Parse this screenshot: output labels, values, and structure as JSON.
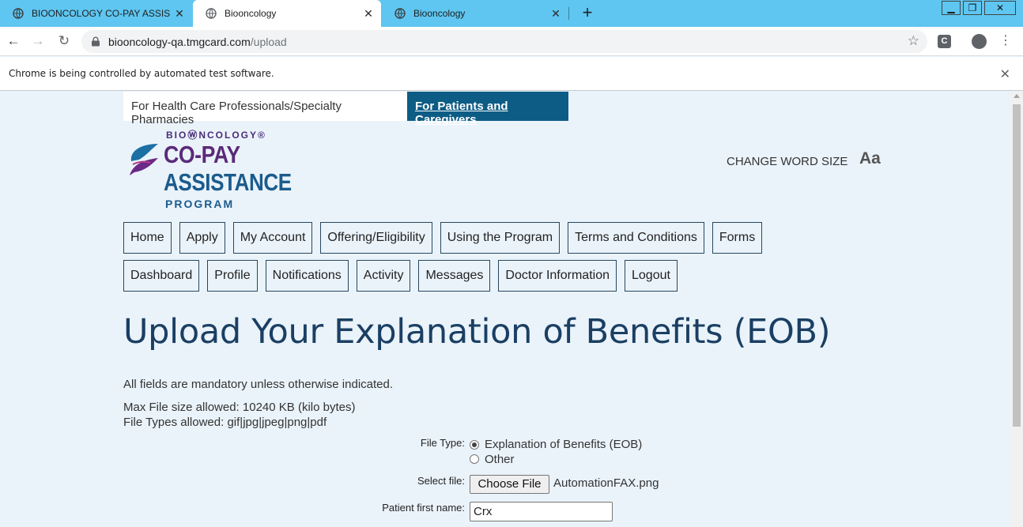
{
  "browser": {
    "tabs": [
      {
        "title": "BIOONCOLOGY CO-PAY ASSISTA",
        "active": false
      },
      {
        "title": "Biooncology",
        "active": true
      },
      {
        "title": "Biooncology",
        "active": false
      }
    ],
    "new_tab_label": "+",
    "window_controls": {
      "minimize": "▁",
      "maximize": "❐",
      "close": "✕"
    },
    "url_host": "biooncology-qa.tmgcard.com",
    "url_path": "/upload",
    "extension_label": "C",
    "automation_message": "Chrome is being controlled by automated test software."
  },
  "site": {
    "audience_tabs": {
      "hcp": "For Health Care Professionals/Specialty Pharmacies",
      "patients": "For Patients and Caregivers"
    },
    "logo": {
      "brand": "BIOⓌNCOLOGY®",
      "line1": "CO-PAY",
      "line2": "ASSISTANCE",
      "line3": "PROGRAM"
    },
    "word_size_label": "CHANGE WORD SIZE",
    "word_size_icon": "Aa",
    "nav_row_1": [
      "Home",
      "Apply",
      "My Account",
      "Offering/Eligibility",
      "Using the Program",
      "Terms and Conditions",
      "Forms"
    ],
    "nav_row_2": [
      "Dashboard",
      "Profile",
      "Notifications",
      "Activity",
      "Messages",
      "Doctor Information",
      "Logout"
    ]
  },
  "upload": {
    "heading": "Upload Your Explanation of Benefits (EOB)",
    "mandatory_note": "All fields are mandatory unless otherwise indicated.",
    "max_size": "Max File size allowed: 10240 KB (kilo bytes)",
    "file_types": "File Types allowed: gif|jpg|jpeg|png|pdf",
    "file_type_label": "File Type:",
    "file_type_options": [
      {
        "label": "Explanation of Benefits (EOB)",
        "selected": true
      },
      {
        "label": "Other",
        "selected": false
      }
    ],
    "select_file_label": "Select file:",
    "choose_file_button": "Choose File",
    "selected_file_name": "AutomationFAX.png",
    "first_name_label": "Patient first name:",
    "first_name_value": "Crx"
  },
  "colors": {
    "tabbar": "#5ec6f0",
    "page_bg": "#eaf3fa",
    "patients_tab": "#0d5c85",
    "heading": "#1b3f63"
  }
}
